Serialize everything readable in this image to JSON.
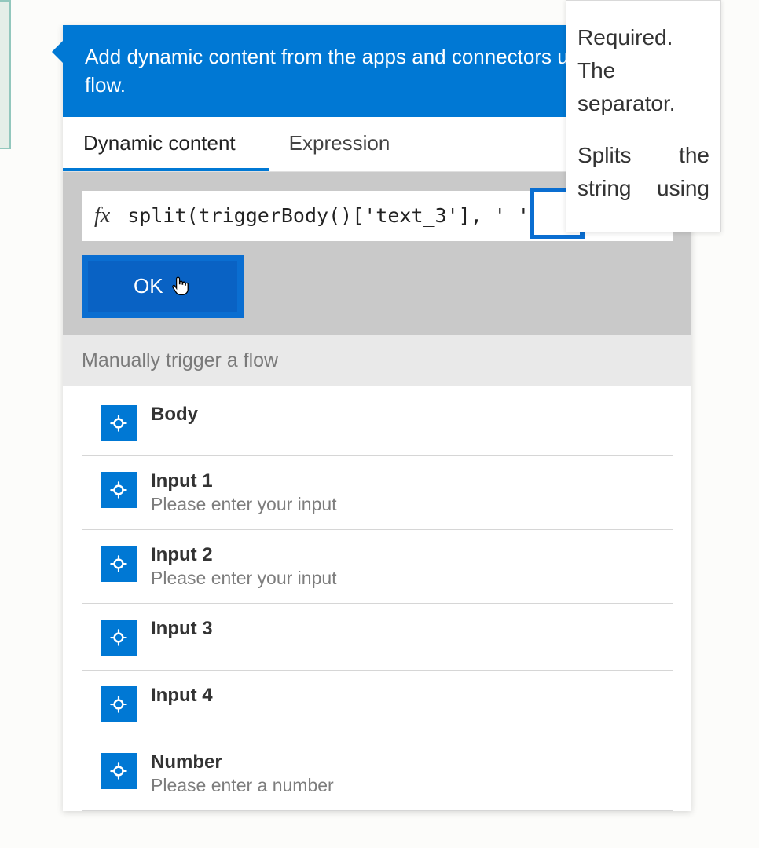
{
  "header": {
    "text": "Add dynamic content from the apps and connectors used in this flow."
  },
  "tabs": {
    "dynamic": "Dynamic content",
    "expression": "Expression"
  },
  "expression": {
    "fx_label": "fx",
    "value": "split(triggerBody()['text_3'], ' '",
    "ok_label": "OK"
  },
  "section": {
    "title": "Manually trigger a flow"
  },
  "items": [
    {
      "title": "Body",
      "sub": ""
    },
    {
      "title": "Input 1",
      "sub": "Please enter your input"
    },
    {
      "title": "Input 2",
      "sub": "Please enter your input"
    },
    {
      "title": "Input 3",
      "sub": ""
    },
    {
      "title": "Input 4",
      "sub": ""
    },
    {
      "title": "Number",
      "sub": "Please enter a number"
    }
  ],
  "tooltip": {
    "line1": "Required. The separator.",
    "line2": "Splits the string using"
  }
}
